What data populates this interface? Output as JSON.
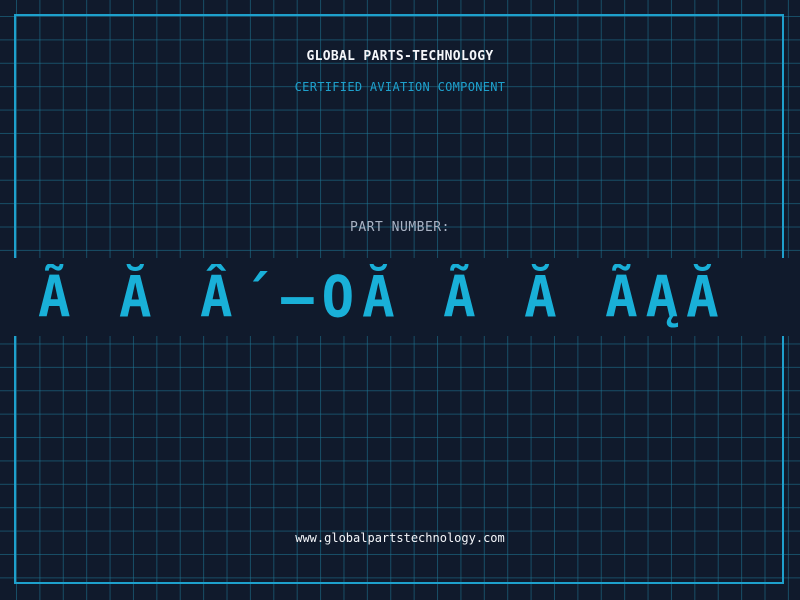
{
  "header": {
    "company": "GLOBAL PARTS-TECHNOLOGY",
    "subtitle": "CERTIFIED AVIATION COMPONENT"
  },
  "part": {
    "label": "PART NUMBER:",
    "value": "Ã Ă Â´—OĂ Ã Ă ÃĄĂ"
  },
  "footer": {
    "website": "www.globalpartstechnology.com"
  },
  "colors": {
    "background": "#101a2c",
    "grid": "#1e7896",
    "accent": "#1ea0cc",
    "part_number": "#19b0d8",
    "text": "#f4f6fa",
    "muted": "#a9b3c4"
  }
}
